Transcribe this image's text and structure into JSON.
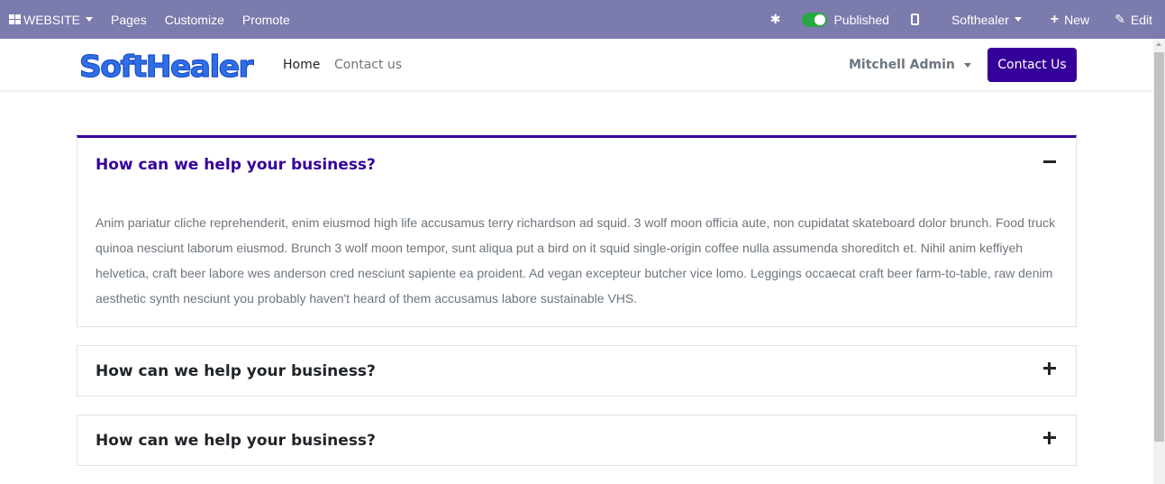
{
  "editor_bar": {
    "website_label": "WEBSITE",
    "pages_label": "Pages",
    "customize_label": "Customize",
    "promote_label": "Promote",
    "published_label": "Published",
    "company_label": "Softhealer",
    "new_label": "New",
    "edit_label": "Edit",
    "background_color": "#7c7bad"
  },
  "header": {
    "logo_text": "SoftHealer",
    "nav": [
      {
        "label": "Home",
        "active": true
      },
      {
        "label": "Contact us",
        "active": false
      }
    ],
    "user_name": "Mitchell Admin",
    "cta_label": "Contact Us",
    "accent_color": "#35009a"
  },
  "accordion": {
    "items": [
      {
        "title": "How can we help your business?",
        "expanded": true,
        "icon": "minus-icon",
        "body": "Anim pariatur cliche reprehenderit, enim eiusmod high life accusamus terry richardson ad squid. 3 wolf moon officia aute, non cupidatat skateboard dolor brunch. Food truck quinoa nesciunt laborum eiusmod. Brunch 3 wolf moon tempor, sunt aliqua put a bird on it squid single-origin coffee nulla assumenda shoreditch et. Nihil anim keffiyeh helvetica, craft beer labore wes anderson cred nesciunt sapiente ea proident. Ad vegan excepteur butcher vice lomo. Leggings occaecat craft beer farm-to-table, raw denim aesthetic synth nesciunt you probably haven't heard of them accusamus labore sustainable VHS."
      },
      {
        "title": "How can we help your business?",
        "expanded": false,
        "icon": "plus-icon"
      },
      {
        "title": "How can we help your business?",
        "expanded": false,
        "icon": "plus-icon"
      }
    ]
  }
}
